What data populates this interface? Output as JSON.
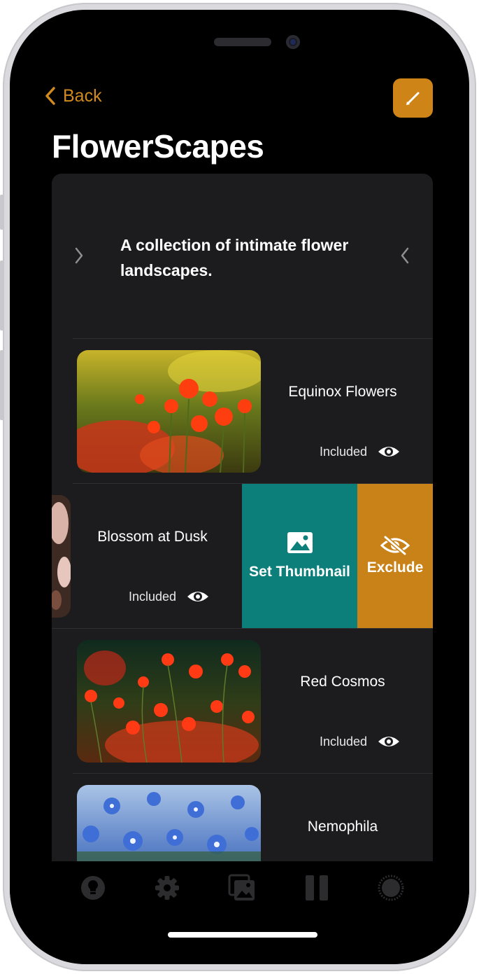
{
  "nav": {
    "back_label": "Back"
  },
  "album": {
    "title": "FlowerScapes",
    "description": "A collection of intimate flower landscapes."
  },
  "photos": [
    {
      "title": "Equinox Flowers",
      "status": "Included",
      "status_icon": "eye-icon"
    },
    {
      "title": "Blossom at Dusk",
      "status": "Included",
      "status_icon": "eye-icon"
    },
    {
      "title": "Red Cosmos",
      "status": "Included",
      "status_icon": "eye-icon"
    },
    {
      "title": "Nemophila"
    }
  ],
  "swipe_actions": {
    "set_thumbnail_label": "Set Thumbnail",
    "exclude_label": "Exclude"
  },
  "tabs": [
    "lightbulb-icon",
    "gear-icon",
    "gallery-icon",
    "pause-icon",
    "circle-icon"
  ],
  "colors": {
    "accent": "#cf8418",
    "teal": "#0d7f7a",
    "card_bg": "#1c1c1e"
  }
}
